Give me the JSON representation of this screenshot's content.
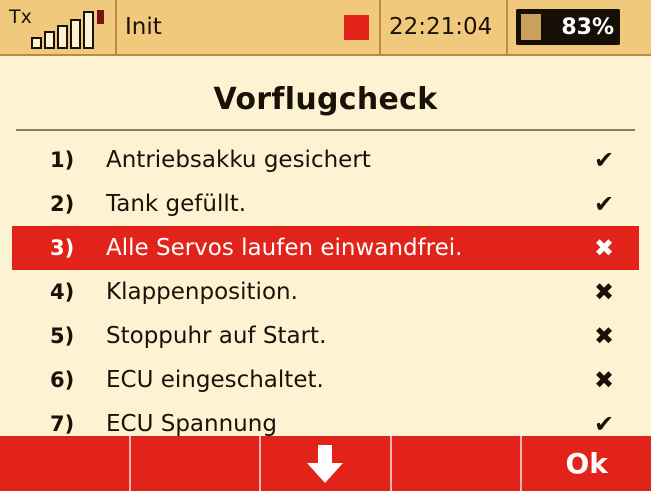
{
  "status": {
    "tx_label": "Tx",
    "model_name": "Init",
    "time": "22:21:04",
    "battery_percent": "83%",
    "battery_level": 0.83,
    "signal_bars": 5,
    "record_indicator_color": "#e2231a"
  },
  "title": "Vorflugcheck",
  "checklist": {
    "selected_index": 2,
    "items": [
      {
        "num": "1)",
        "label": "Antriebsakku gesichert",
        "mark": "✔",
        "checked": true
      },
      {
        "num": "2)",
        "label": "Tank gefüllt.",
        "mark": "✔",
        "checked": true
      },
      {
        "num": "3)",
        "label": "Alle Servos laufen einwandfrei.",
        "mark": "✖",
        "checked": false
      },
      {
        "num": "4)",
        "label": "Klappenposition.",
        "mark": "✖",
        "checked": false
      },
      {
        "num": "5)",
        "label": "Stoppuhr auf Start.",
        "mark": "✖",
        "checked": false
      },
      {
        "num": "6)",
        "label": "ECU eingeschaltet.",
        "mark": "✖",
        "checked": false
      },
      {
        "num": "7)",
        "label": "ECU Spannung",
        "mark": "✔",
        "checked": true
      }
    ]
  },
  "buttons": {
    "f1": "",
    "f2": "",
    "f3_icon": "arrow-down-icon",
    "f4": "",
    "f5": "Ok"
  },
  "colors": {
    "background": "#fdf3d2",
    "statusbar": "#f1c97d",
    "accent_red": "#e2231a"
  }
}
